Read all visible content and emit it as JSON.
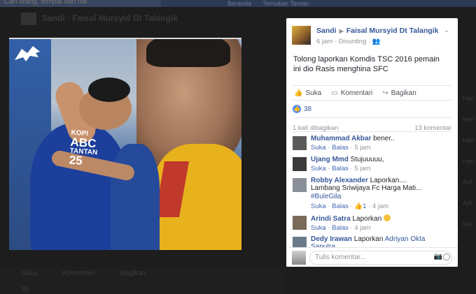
{
  "background": {
    "search_placeholder": "Cari orang, tempat dan hal",
    "topnav": [
      "Beranda",
      "Temukan Teman"
    ],
    "header_title": "Sandi · Faisal Mursyid Dt Talangik",
    "bottom_actions": [
      "Suka",
      "Komentari",
      "Bagikan"
    ],
    "bottom_likes": "38",
    "sidebar_labels": [
      "Hen",
      "Hen",
      "Hen",
      "Hen",
      "Adi",
      "Adi",
      "Me"
    ]
  },
  "post": {
    "author": "Sandi",
    "target": "Faisal Mursyid Dt Talangik",
    "time": "6 jam",
    "edited": "Disunting",
    "text": "Tolong laporkan Komdis TSC 2016 pemain ini dio Rasis menghina SFC",
    "actions": {
      "like": "Suka",
      "comment": "Komentari",
      "share": "Bagikan"
    },
    "likes_count": "38",
    "shares": "1 kali dibagikan",
    "comments_count": "13 komentar"
  },
  "comments": [
    {
      "name": "Muhammad Akbar",
      "text": "bener..",
      "like": "Suka",
      "reply": "Balas",
      "time": "5 jam",
      "avatar_color": "#5a5a5a"
    },
    {
      "name": "Ujang Mmd",
      "text": "Stujuuuuu,",
      "like": "Suka",
      "reply": "Balas",
      "time": "5 jam",
      "avatar_color": "#3b3b3b"
    },
    {
      "name": "Robby Alexander",
      "text": "Laporkan....",
      "line2": "Lambang Sriwijaya Fc Harga Mati...",
      "tag": "#BuleGila",
      "like": "Suka",
      "reply": "Balas",
      "reactions": "1",
      "time": "4 jam",
      "avatar_color": "#8a8f99"
    },
    {
      "name": "Arindi Satra",
      "text": "Laporkan",
      "like": "Suka",
      "reply": "Balas",
      "time": "4 jam",
      "avatar_color": "#7a6a5a"
    },
    {
      "name": "Dedy Irawan",
      "text": "Laporkan",
      "mention": "Adriyan Okta Saputra",
      "avatar_color": "#6a7a8a"
    }
  ],
  "comment_input": {
    "placeholder": "Tulis komentar..."
  },
  "photo": {
    "shirt_sponsor1": "KOPI",
    "shirt_sponsor2": "ABC",
    "shirt_name": "TANTAN",
    "shirt_number": "25"
  },
  "colors": {
    "link": "#365899",
    "meta": "#90949c",
    "like_blue": "#5890ff"
  }
}
